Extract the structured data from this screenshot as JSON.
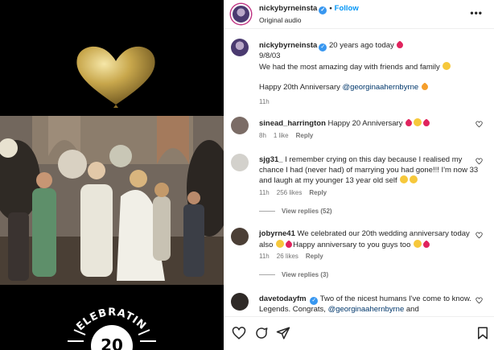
{
  "post": {
    "author": "nickybyrneinsta",
    "follow_label": "Follow",
    "audio": "Original audio",
    "caption": {
      "time": "20 years ago today",
      "date": "9/8/03",
      "line1": "We had the most amazing day with friends and family",
      "line2_prefix": "Happy 20th Anniversary ",
      "mention": "@georginaahernbyrne",
      "age": "11h"
    },
    "badge_text": "CELEBRATING",
    "badge_number": "20"
  },
  "comments": [
    {
      "user": "sinead_harrington",
      "text": "Happy 20 Anniversary",
      "age": "8h",
      "likes": "1 like",
      "reply": "Reply"
    },
    {
      "user": "sjg31_",
      "text": "I remember crying on this day because I realised my chance I had (never had) of marrying you had gone!!! I'm now 33 and laugh at my younger 13 year old self",
      "age": "11h",
      "likes": "256 likes",
      "reply": "Reply",
      "view_replies": "View replies (52)"
    },
    {
      "user": "jobyrne41",
      "text": "We celebrated our 20th wedding anniversary today also",
      "text2": "Happy anniversary to you guys too",
      "age": "11h",
      "likes": "26 likes",
      "reply": "Reply",
      "view_replies": "View replies (3)"
    },
    {
      "user": "davetodayfm",
      "text": "Two of the nicest humans I've come to know. Legends. Congrats,",
      "mention": "@georginaahernbyrne",
      "tail": "and"
    }
  ],
  "icons": {
    "like": "heart-icon",
    "comment": "comment-icon",
    "share": "send-icon",
    "save": "bookmark-icon"
  },
  "colors": {
    "link": "#0095f6",
    "verified": "#3897f0",
    "heart": "#e0245e"
  }
}
